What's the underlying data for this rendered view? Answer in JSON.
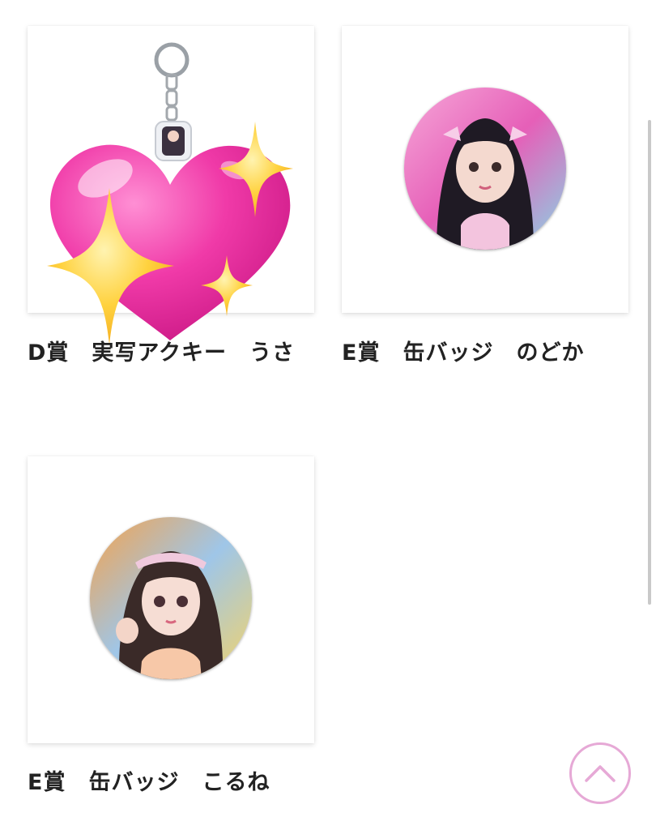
{
  "products": [
    {
      "title": "D賞　実写アクキー　うさ"
    },
    {
      "title": "E賞　缶バッジ　のどか"
    },
    {
      "title": "E賞　缶バッジ　こるね"
    }
  ],
  "icons": {
    "overlay": [
      "sparkling-heart-icon",
      "sparkles-icon"
    ],
    "scroll_top": "chevron-up-icon"
  },
  "colors": {
    "accent": "#e6a9d6",
    "heart": "#f03aa8",
    "sparkle": "#ffc933"
  }
}
